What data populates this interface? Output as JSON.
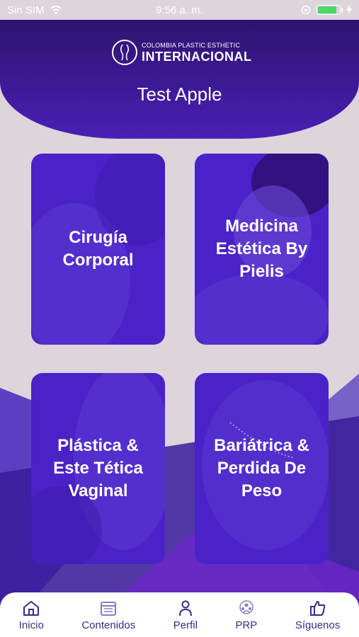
{
  "status_bar": {
    "carrier": "Sin SIM",
    "time": "9:56 a. m."
  },
  "header": {
    "logo_line1": "COLOMBIA PLASTIC ESTHETIC",
    "logo_line2": "INTERNACIONAL",
    "user_name": "Test Apple"
  },
  "cards": [
    {
      "label": "Cirugía Corporal"
    },
    {
      "label": "Medicina Estética By Pielis"
    },
    {
      "label": "Plástica & Este Tética Vaginal"
    },
    {
      "label": "Bariátrica & Perdida De Peso"
    }
  ],
  "tabs": [
    {
      "label": "Inicio",
      "icon": "home-icon"
    },
    {
      "label": "Contenidos",
      "icon": "calendar-icon"
    },
    {
      "label": "Perfil",
      "icon": "person-icon"
    },
    {
      "label": "PRP",
      "icon": "group-icon"
    },
    {
      "label": "Síguenos",
      "icon": "thumbs-up-icon"
    }
  ],
  "colors": {
    "header_dark": "#2e1470",
    "header_light": "#4a1fb5",
    "card_tint": "#4a22c8",
    "tab_text": "#3a2a8a",
    "battery": "#4cd964"
  }
}
